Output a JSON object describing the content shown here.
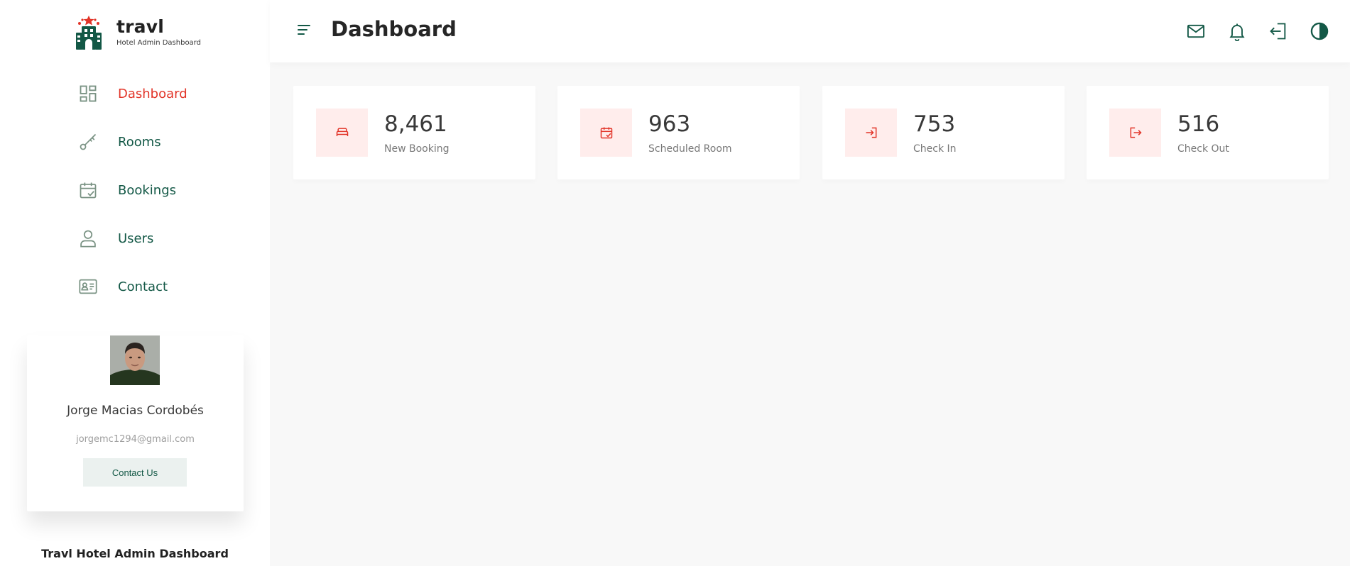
{
  "brand": {
    "name": "travl",
    "subtitle": "Hotel Admin Dashboard",
    "colors": {
      "primary": "#135846",
      "accent": "#e23428",
      "muted": "#799283"
    }
  },
  "nav": {
    "items": [
      {
        "label": "Dashboard",
        "icon": "dashboard-grid-icon",
        "active": true
      },
      {
        "label": "Rooms",
        "icon": "key-icon",
        "active": false
      },
      {
        "label": "Bookings",
        "icon": "calendar-check-icon",
        "active": false
      },
      {
        "label": "Users",
        "icon": "user-icon",
        "active": false
      },
      {
        "label": "Contact",
        "icon": "contact-card-icon",
        "active": false
      }
    ]
  },
  "profile": {
    "name": "Jorge Macias Cordobés",
    "email": "jorgemc1294@gmail.com",
    "button_label": "Contact Us"
  },
  "footer": {
    "title": "Travl Hotel Admin Dashboard"
  },
  "header": {
    "title": "Dashboard",
    "icons": [
      "menu-icon",
      "mail-icon",
      "bell-icon",
      "logout-icon",
      "theme-toggle-icon"
    ]
  },
  "kpis": [
    {
      "value": "8,461",
      "label": "New Booking",
      "icon": "bed-icon"
    },
    {
      "value": "963",
      "label": "Scheduled Room",
      "icon": "calendar-check-icon"
    },
    {
      "value": "753",
      "label": "Check In",
      "icon": "check-in-icon"
    },
    {
      "value": "516",
      "label": "Check Out",
      "icon": "check-out-icon"
    }
  ]
}
